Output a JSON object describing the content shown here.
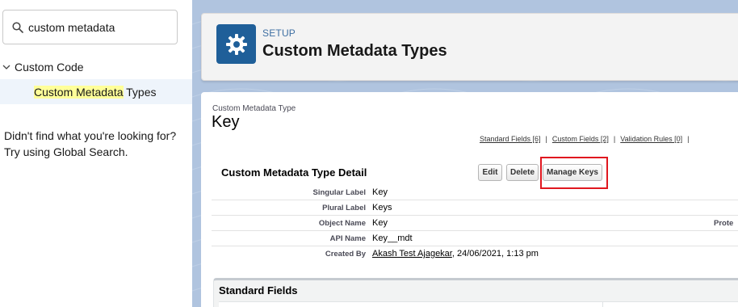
{
  "sidebar": {
    "search_value": "custom metadata",
    "tree_parent_label": "Custom Code",
    "tree_child_highlight": "Custom Metadata",
    "tree_child_rest": " Types",
    "not_found_line1": "Didn't find what you're looking for?",
    "not_found_line2": "Try using Global Search."
  },
  "header": {
    "section": "SETUP",
    "title": "Custom Metadata Types",
    "icon": "gear-icon",
    "tile_color": "#1f5f99"
  },
  "record": {
    "type_label": "Custom Metadata Type",
    "name": "Key",
    "related_links": [
      "Standard Fields [6]",
      "Custom Fields [2]",
      "Validation Rules [0]"
    ],
    "detail_title": "Custom Metadata Type Detail",
    "buttons": {
      "edit": "Edit",
      "delete": "Delete",
      "manage_keys": "Manage Keys"
    },
    "fields": [
      {
        "label": "Singular Label",
        "value": "Key"
      },
      {
        "label": "Plural Label",
        "value": "Keys"
      },
      {
        "label": "Object Name",
        "value": "Key",
        "extra": "Prote"
      },
      {
        "label": "API Name",
        "value": "Key__mdt"
      },
      {
        "label": "Created By",
        "link": "Akash Test Ajagekar",
        "value": ", 24/06/2021, 1:13 pm"
      }
    ],
    "standard_fields_title": "Standard Fields"
  },
  "colors": {
    "highlight_box": "#e0171f",
    "selected_row": "#eef4fb",
    "search_highlight": "#ffff99"
  }
}
